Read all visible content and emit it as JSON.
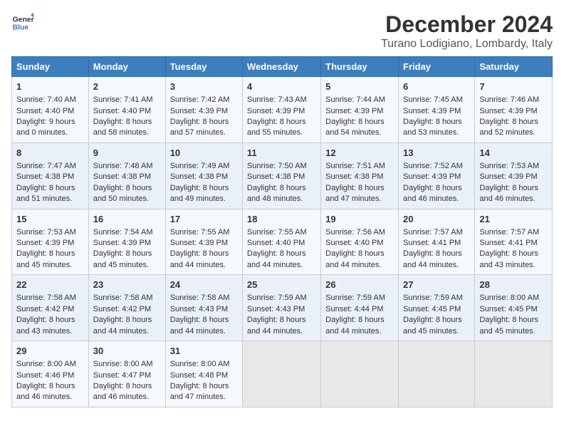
{
  "logo": {
    "line1": "General",
    "line2": "Blue"
  },
  "title": "December 2024",
  "subtitle": "Turano Lodigiano, Lombardy, Italy",
  "days_of_week": [
    "Sunday",
    "Monday",
    "Tuesday",
    "Wednesday",
    "Thursday",
    "Friday",
    "Saturday"
  ],
  "weeks": [
    [
      {
        "day": "1",
        "sunrise": "Sunrise: 7:40 AM",
        "sunset": "Sunset: 4:40 PM",
        "daylight": "Daylight: 9 hours and 0 minutes."
      },
      {
        "day": "2",
        "sunrise": "Sunrise: 7:41 AM",
        "sunset": "Sunset: 4:40 PM",
        "daylight": "Daylight: 8 hours and 58 minutes."
      },
      {
        "day": "3",
        "sunrise": "Sunrise: 7:42 AM",
        "sunset": "Sunset: 4:39 PM",
        "daylight": "Daylight: 8 hours and 57 minutes."
      },
      {
        "day": "4",
        "sunrise": "Sunrise: 7:43 AM",
        "sunset": "Sunset: 4:39 PM",
        "daylight": "Daylight: 8 hours and 55 minutes."
      },
      {
        "day": "5",
        "sunrise": "Sunrise: 7:44 AM",
        "sunset": "Sunset: 4:39 PM",
        "daylight": "Daylight: 8 hours and 54 minutes."
      },
      {
        "day": "6",
        "sunrise": "Sunrise: 7:45 AM",
        "sunset": "Sunset: 4:39 PM",
        "daylight": "Daylight: 8 hours and 53 minutes."
      },
      {
        "day": "7",
        "sunrise": "Sunrise: 7:46 AM",
        "sunset": "Sunset: 4:39 PM",
        "daylight": "Daylight: 8 hours and 52 minutes."
      }
    ],
    [
      {
        "day": "8",
        "sunrise": "Sunrise: 7:47 AM",
        "sunset": "Sunset: 4:38 PM",
        "daylight": "Daylight: 8 hours and 51 minutes."
      },
      {
        "day": "9",
        "sunrise": "Sunrise: 7:48 AM",
        "sunset": "Sunset: 4:38 PM",
        "daylight": "Daylight: 8 hours and 50 minutes."
      },
      {
        "day": "10",
        "sunrise": "Sunrise: 7:49 AM",
        "sunset": "Sunset: 4:38 PM",
        "daylight": "Daylight: 8 hours and 49 minutes."
      },
      {
        "day": "11",
        "sunrise": "Sunrise: 7:50 AM",
        "sunset": "Sunset: 4:38 PM",
        "daylight": "Daylight: 8 hours and 48 minutes."
      },
      {
        "day": "12",
        "sunrise": "Sunrise: 7:51 AM",
        "sunset": "Sunset: 4:38 PM",
        "daylight": "Daylight: 8 hours and 47 minutes."
      },
      {
        "day": "13",
        "sunrise": "Sunrise: 7:52 AM",
        "sunset": "Sunset: 4:39 PM",
        "daylight": "Daylight: 8 hours and 46 minutes."
      },
      {
        "day": "14",
        "sunrise": "Sunrise: 7:53 AM",
        "sunset": "Sunset: 4:39 PM",
        "daylight": "Daylight: 8 hours and 46 minutes."
      }
    ],
    [
      {
        "day": "15",
        "sunrise": "Sunrise: 7:53 AM",
        "sunset": "Sunset: 4:39 PM",
        "daylight": "Daylight: 8 hours and 45 minutes."
      },
      {
        "day": "16",
        "sunrise": "Sunrise: 7:54 AM",
        "sunset": "Sunset: 4:39 PM",
        "daylight": "Daylight: 8 hours and 45 minutes."
      },
      {
        "day": "17",
        "sunrise": "Sunrise: 7:55 AM",
        "sunset": "Sunset: 4:39 PM",
        "daylight": "Daylight: 8 hours and 44 minutes."
      },
      {
        "day": "18",
        "sunrise": "Sunrise: 7:55 AM",
        "sunset": "Sunset: 4:40 PM",
        "daylight": "Daylight: 8 hours and 44 minutes."
      },
      {
        "day": "19",
        "sunrise": "Sunrise: 7:56 AM",
        "sunset": "Sunset: 4:40 PM",
        "daylight": "Daylight: 8 hours and 44 minutes."
      },
      {
        "day": "20",
        "sunrise": "Sunrise: 7:57 AM",
        "sunset": "Sunset: 4:41 PM",
        "daylight": "Daylight: 8 hours and 44 minutes."
      },
      {
        "day": "21",
        "sunrise": "Sunrise: 7:57 AM",
        "sunset": "Sunset: 4:41 PM",
        "daylight": "Daylight: 8 hours and 43 minutes."
      }
    ],
    [
      {
        "day": "22",
        "sunrise": "Sunrise: 7:58 AM",
        "sunset": "Sunset: 4:42 PM",
        "daylight": "Daylight: 8 hours and 43 minutes."
      },
      {
        "day": "23",
        "sunrise": "Sunrise: 7:58 AM",
        "sunset": "Sunset: 4:42 PM",
        "daylight": "Daylight: 8 hours and 44 minutes."
      },
      {
        "day": "24",
        "sunrise": "Sunrise: 7:58 AM",
        "sunset": "Sunset: 4:43 PM",
        "daylight": "Daylight: 8 hours and 44 minutes."
      },
      {
        "day": "25",
        "sunrise": "Sunrise: 7:59 AM",
        "sunset": "Sunset: 4:43 PM",
        "daylight": "Daylight: 8 hours and 44 minutes."
      },
      {
        "day": "26",
        "sunrise": "Sunrise: 7:59 AM",
        "sunset": "Sunset: 4:44 PM",
        "daylight": "Daylight: 8 hours and 44 minutes."
      },
      {
        "day": "27",
        "sunrise": "Sunrise: 7:59 AM",
        "sunset": "Sunset: 4:45 PM",
        "daylight": "Daylight: 8 hours and 45 minutes."
      },
      {
        "day": "28",
        "sunrise": "Sunrise: 8:00 AM",
        "sunset": "Sunset: 4:45 PM",
        "daylight": "Daylight: 8 hours and 45 minutes."
      }
    ],
    [
      {
        "day": "29",
        "sunrise": "Sunrise: 8:00 AM",
        "sunset": "Sunset: 4:46 PM",
        "daylight": "Daylight: 8 hours and 46 minutes."
      },
      {
        "day": "30",
        "sunrise": "Sunrise: 8:00 AM",
        "sunset": "Sunset: 4:47 PM",
        "daylight": "Daylight: 8 hours and 46 minutes."
      },
      {
        "day": "31",
        "sunrise": "Sunrise: 8:00 AM",
        "sunset": "Sunset: 4:48 PM",
        "daylight": "Daylight: 8 hours and 47 minutes."
      },
      null,
      null,
      null,
      null
    ]
  ]
}
